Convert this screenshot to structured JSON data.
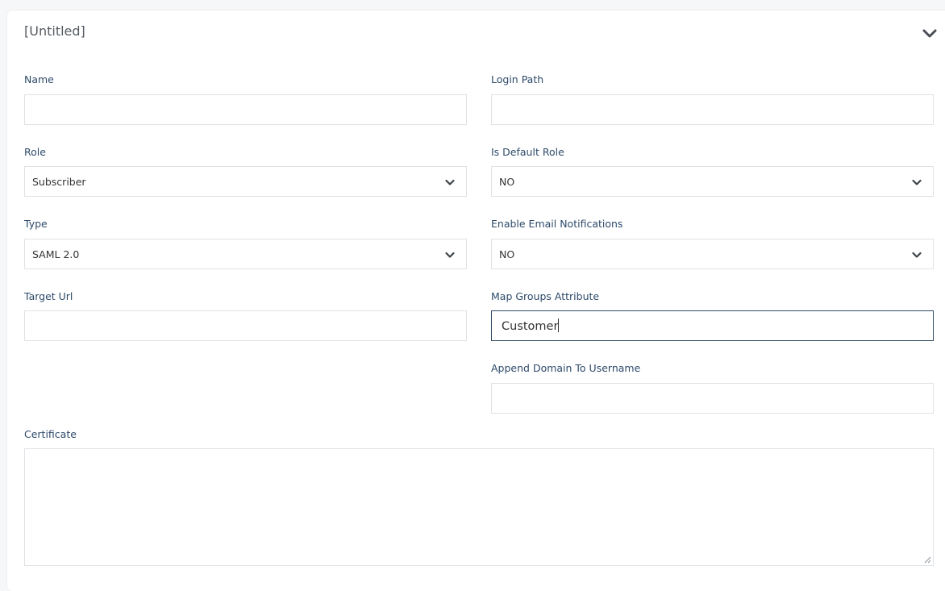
{
  "panel": {
    "title": "[Untitled]"
  },
  "form": {
    "name": {
      "label": "Name",
      "value": ""
    },
    "login_path": {
      "label": "Login Path",
      "value": ""
    },
    "role": {
      "label": "Role",
      "value": "Subscriber"
    },
    "is_default_role": {
      "label": "Is Default Role",
      "value": "NO"
    },
    "type": {
      "label": "Type",
      "value": "SAML 2.0"
    },
    "enable_email_notifications": {
      "label": "Enable Email Notifications",
      "value": "NO"
    },
    "target_url": {
      "label": "Target Url",
      "value": ""
    },
    "map_groups_attribute": {
      "label": "Map Groups Attribute",
      "value": "Customer"
    },
    "append_domain_to_username": {
      "label": "Append Domain To Username",
      "value": ""
    },
    "certificate": {
      "label": "Certificate",
      "value": ""
    }
  },
  "icons": {
    "collapse": "chevron-down-icon",
    "select_arrow": "chevron-down-icon",
    "resize": "resize-grip-icon"
  },
  "colors": {
    "label": "#2d4a6a",
    "border": "#dfe2e6",
    "focus_border": "#2f4a63",
    "background": "#f6f7f8"
  }
}
